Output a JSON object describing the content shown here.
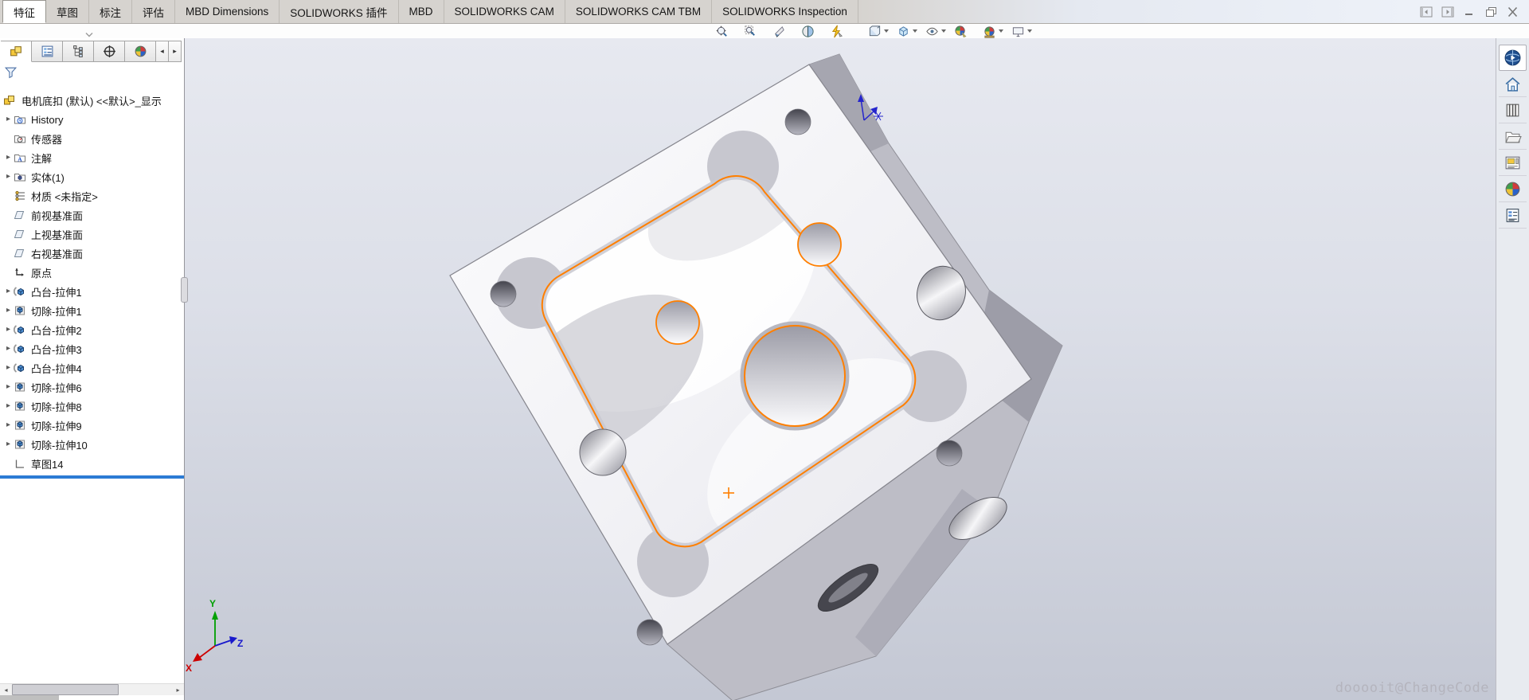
{
  "window": {
    "controls": [
      {
        "name": "dock-left"
      },
      {
        "name": "dock-right"
      },
      {
        "name": "minimize"
      },
      {
        "name": "restore"
      },
      {
        "name": "close"
      }
    ]
  },
  "ribbon": {
    "tabs": [
      {
        "label": "特征",
        "active": true
      },
      {
        "label": "草图"
      },
      {
        "label": "标注"
      },
      {
        "label": "评估"
      },
      {
        "label": "MBD Dimensions"
      },
      {
        "label": "SOLIDWORKS 插件"
      },
      {
        "label": "MBD"
      },
      {
        "label": "SOLIDWORKS CAM"
      },
      {
        "label": "SOLIDWORKS CAM TBM"
      },
      {
        "label": "SOLIDWORKS Inspection"
      }
    ]
  },
  "view_toolbar": {
    "items": [
      {
        "name": "zoom-to-fit"
      },
      {
        "name": "zoom-to-area"
      },
      {
        "name": "previous-view"
      },
      {
        "name": "section-view"
      },
      {
        "name": "dynamic-annotation-views"
      },
      {
        "name": "view-orientation",
        "dropdown": true,
        "gap": true
      },
      {
        "name": "display-style",
        "dropdown": true
      },
      {
        "name": "hide-show-items",
        "dropdown": true
      },
      {
        "name": "edit-appearance"
      },
      {
        "name": "apply-scene",
        "dropdown": true
      },
      {
        "name": "view-settings",
        "dropdown": true
      }
    ]
  },
  "feature_panel": {
    "tabs": [
      {
        "name": "featuremanager",
        "active": true
      },
      {
        "name": "propertymanager"
      },
      {
        "name": "configurationmanager"
      },
      {
        "name": "dimxpertmanager"
      },
      {
        "name": "displaymanager"
      }
    ],
    "scroll_left": "◂",
    "scroll_right": "▸",
    "root_label": "电机底扣 (默认) <<默认>_显示",
    "tree": [
      {
        "label": "History",
        "icon": "history-folder",
        "arrow": true
      },
      {
        "label": "传感器",
        "icon": "sensors-folder",
        "arrow": false
      },
      {
        "label": "注解",
        "icon": "annotations-folder",
        "arrow": true
      },
      {
        "label": "实体(1)",
        "icon": "solids-folder",
        "arrow": true
      },
      {
        "label": "材质 <未指定>",
        "icon": "material",
        "arrow": false
      },
      {
        "label": "前视基准面",
        "icon": "plane",
        "arrow": false
      },
      {
        "label": "上视基准面",
        "icon": "plane",
        "arrow": false
      },
      {
        "label": "右视基准面",
        "icon": "plane",
        "arrow": false
      },
      {
        "label": "原点",
        "icon": "origin",
        "arrow": false
      },
      {
        "label": "凸台-拉伸1",
        "icon": "boss-extrude",
        "arrow": true
      },
      {
        "label": "切除-拉伸1",
        "icon": "cut-extrude",
        "arrow": true
      },
      {
        "label": "凸台-拉伸2",
        "icon": "boss-extrude",
        "arrow": true
      },
      {
        "label": "凸台-拉伸3",
        "icon": "boss-extrude",
        "arrow": true
      },
      {
        "label": "凸台-拉伸4",
        "icon": "boss-extrude",
        "arrow": true
      },
      {
        "label": "切除-拉伸6",
        "icon": "cut-extrude",
        "arrow": true
      },
      {
        "label": "切除-拉伸8",
        "icon": "cut-extrude",
        "arrow": true
      },
      {
        "label": "切除-拉伸9",
        "icon": "cut-extrude",
        "arrow": true
      },
      {
        "label": "切除-拉伸10",
        "icon": "cut-extrude",
        "arrow": true
      },
      {
        "label": "草图14",
        "icon": "sketch",
        "arrow": false
      }
    ]
  },
  "taskpane": {
    "tabs": [
      {
        "name": "solidworks-resources",
        "active": true
      },
      {
        "name": "home"
      },
      {
        "name": "design-library"
      },
      {
        "name": "file-explorer"
      },
      {
        "name": "view-palette"
      },
      {
        "name": "appearances-scenes"
      },
      {
        "name": "custom-properties"
      }
    ]
  },
  "viewport": {
    "watermark": "dooooit@ChangeCode",
    "triad": {
      "x": "X",
      "y": "Y",
      "z": "Z"
    },
    "colors": {
      "sketch_orange": "#ff7f00",
      "rollback_bar": "#2b7bd4",
      "triad_x": "#cc0000",
      "triad_y": "#00a000",
      "triad_z": "#1818cc"
    }
  }
}
